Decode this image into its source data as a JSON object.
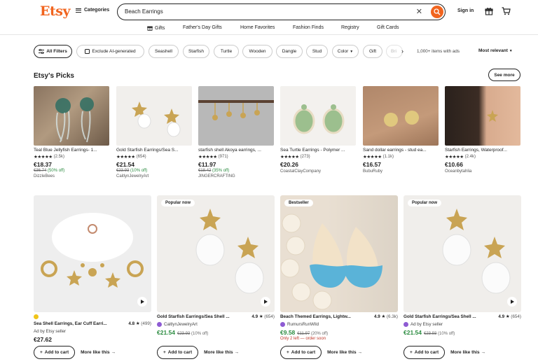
{
  "header": {
    "logo": "Etsy",
    "categories_label": "Categories",
    "search_value": "Beach Earrings",
    "sign_in": "Sign in"
  },
  "nav": {
    "items": [
      "Gifts",
      "Father's Day Gifts",
      "Home Favorites",
      "Fashion Finds",
      "Registry",
      "Gift Cards"
    ]
  },
  "filters": {
    "all_filters": "All Filters",
    "chips": [
      "Exclude AI-generated",
      "Seashell",
      "Starfish",
      "Turtle",
      "Wooden",
      "Dangle",
      "Stud",
      "Color",
      "Gift",
      "Bri"
    ],
    "items_count": "1,000+ items with ads",
    "sort_label": "Most relevant"
  },
  "picks": {
    "title": "Etsy's Picks",
    "see_more": "See more",
    "items": [
      {
        "title": "Teal Blue Jellyfish Earrings- 1...",
        "stars": "★★★★★",
        "reviews": "(2.5k)",
        "price": "€18.37",
        "original": "€36.74",
        "discount": "(50% off)",
        "shop": "DizzleBees"
      },
      {
        "title": "Gold Starfish Earrings/Sea S...",
        "stars": "★★★★★",
        "reviews": "(654)",
        "price": "€21.54",
        "original": "€23.93",
        "discount": "(10% off)",
        "shop": "CaitlynJewelryArt"
      },
      {
        "title": "starfish shell Akoya earrings, ...",
        "stars": "★★★★★",
        "reviews": "(971)",
        "price": "€11.97",
        "original": "€18.42",
        "discount": "(35% off)",
        "shop": "JINGERCRAFTING"
      },
      {
        "title": "Sea Turtle Earrings - Polymer ...",
        "stars": "★★★★★",
        "reviews": "(273)",
        "price": "€20.26",
        "original": "",
        "discount": "",
        "shop": "CoastalClayCompany"
      },
      {
        "title": "Sand dollar earrings - stud ea...",
        "stars": "★★★★★",
        "reviews": "(1.1k)",
        "price": "€16.57",
        "original": "",
        "discount": "",
        "shop": "BubuRuby"
      },
      {
        "title": "Starfish Earrings, Waterproof...",
        "stars": "★★★★★",
        "reviews": "(2.4k)",
        "price": "€10.66",
        "original": "",
        "discount": "",
        "shop": "Oceanbytahlia"
      }
    ]
  },
  "listings": [
    {
      "badge": "",
      "title": "Sea Shell Earrings, Ear Cuff Earri...",
      "rating": "4.8",
      "count": "(499)",
      "seller": "Ad by Etsy seller",
      "price": "€27.62",
      "original": "",
      "discount": "",
      "stock": "",
      "add_to_cart": "Add to cart",
      "more_like": "More like this"
    },
    {
      "badge": "Popular now",
      "title": "Gold Starfish Earrings/Sea Shell ...",
      "rating": "4.9",
      "count": "(654)",
      "seller": "CaitlynJewelryArt",
      "price": "€21.54",
      "original": "€23.93",
      "discount": "(10% off)",
      "stock": "",
      "add_to_cart": "Add to cart",
      "more_like": "More like this"
    },
    {
      "badge": "Bestseller",
      "title": "Beach Themed Earrings, Lightw...",
      "rating": "4.9",
      "count": "(6.3k)",
      "seller": "RumursRunWild",
      "price": "€9.58",
      "original": "€11.97",
      "discount": "(20% off)",
      "stock": "Only 2 left — order soon",
      "add_to_cart": "Add to cart",
      "more_like": "More like this"
    },
    {
      "badge": "Popular now",
      "title": "Gold Starfish Earrings/Sea Shell ...",
      "rating": "4.9",
      "count": "(654)",
      "seller": "Ad by Etsy seller",
      "price": "€21.54",
      "original": "€23.93",
      "discount": "(10% off)",
      "stock": "",
      "add_to_cart": "Add to cart",
      "more_like": "More like this"
    }
  ],
  "colors": {
    "brand": "#f1641e",
    "discount_green": "#2c8c41",
    "stock_red": "#c0392b"
  }
}
